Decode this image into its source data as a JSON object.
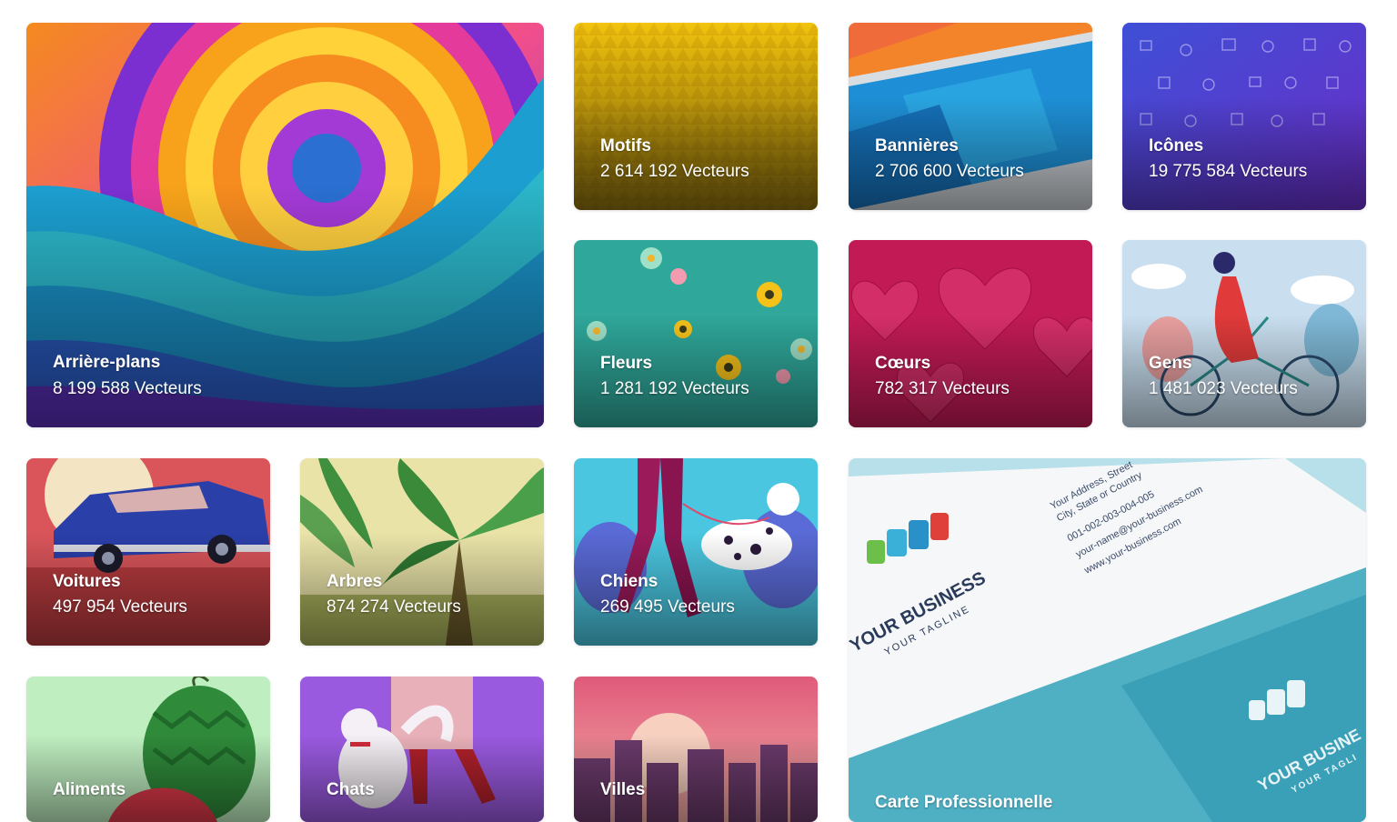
{
  "vector_unit": "Vecteurs",
  "categories": [
    {
      "id": "backgrounds",
      "title": "Arrière-plans",
      "count": "8 199 588 Vecteurs"
    },
    {
      "id": "patterns",
      "title": "Motifs",
      "count": "2 614 192 Vecteurs"
    },
    {
      "id": "banners",
      "title": "Bannières",
      "count": "2 706 600 Vecteurs"
    },
    {
      "id": "icons",
      "title": "Icônes",
      "count": "19 775 584 Vecteurs"
    },
    {
      "id": "flowers",
      "title": "Fleurs",
      "count": "1 281 192 Vecteurs"
    },
    {
      "id": "hearts",
      "title": "Cœurs",
      "count": "782 317 Vecteurs"
    },
    {
      "id": "people",
      "title": "Gens",
      "count": "1 481 023 Vecteurs"
    },
    {
      "id": "cars",
      "title": "Voitures",
      "count": "497 954 Vecteurs"
    },
    {
      "id": "trees",
      "title": "Arbres",
      "count": "874 274 Vecteurs"
    },
    {
      "id": "dogs",
      "title": "Chiens",
      "count": "269 495 Vecteurs"
    },
    {
      "id": "business-card",
      "title": "Carte Professionnelle"
    },
    {
      "id": "food",
      "title": "Aliments"
    },
    {
      "id": "cats",
      "title": "Chats"
    },
    {
      "id": "cities",
      "title": "Villes"
    }
  ],
  "business_card_art": {
    "brand": "YOUR BUSINESS",
    "tagline": "YOUR TAGLINE",
    "address": "Your Address, Street",
    "city": "City, State or Country",
    "phone": "001-002-003-004-005",
    "email": "your-name@your-business.com",
    "website": "www.your-business.com",
    "back_brand": "YOUR BUSINE",
    "back_tagline": "YOUR TAGLI"
  },
  "colors": {
    "background": "#ffffff",
    "text": "#ffffff"
  }
}
